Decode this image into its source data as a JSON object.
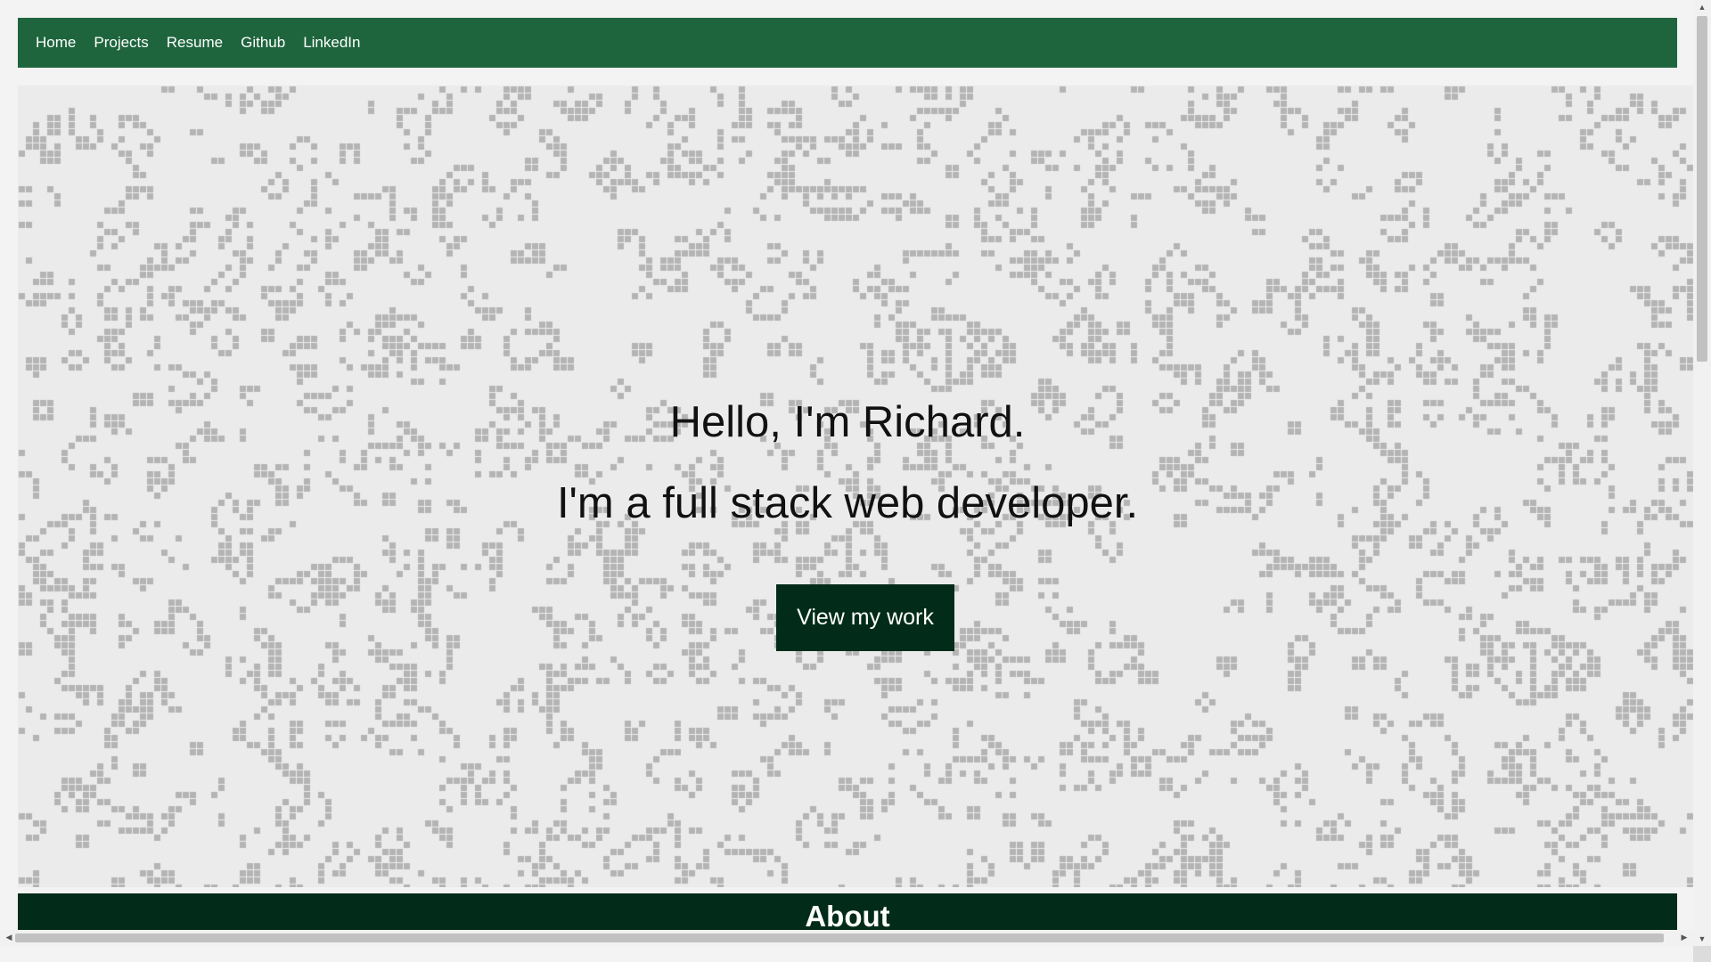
{
  "nav": {
    "links": [
      {
        "label": "Home"
      },
      {
        "label": "Projects"
      },
      {
        "label": "Resume"
      },
      {
        "label": "Github"
      },
      {
        "label": "LinkedIn"
      }
    ]
  },
  "hero": {
    "greeting": "Hello, I'm Richard.",
    "tagline": "I'm a full stack web developer.",
    "cta_label": "View my work"
  },
  "sections": {
    "about_title": "About"
  },
  "colors": {
    "nav_background": "#1e653d",
    "dark_green": "#022c19",
    "hero_background": "#ebebeb",
    "pattern_cells": "#b4b4b4"
  },
  "icons": {
    "scroll_up": "▲",
    "scroll_down": "▼",
    "scroll_left": "◀",
    "scroll_right": "▶"
  }
}
